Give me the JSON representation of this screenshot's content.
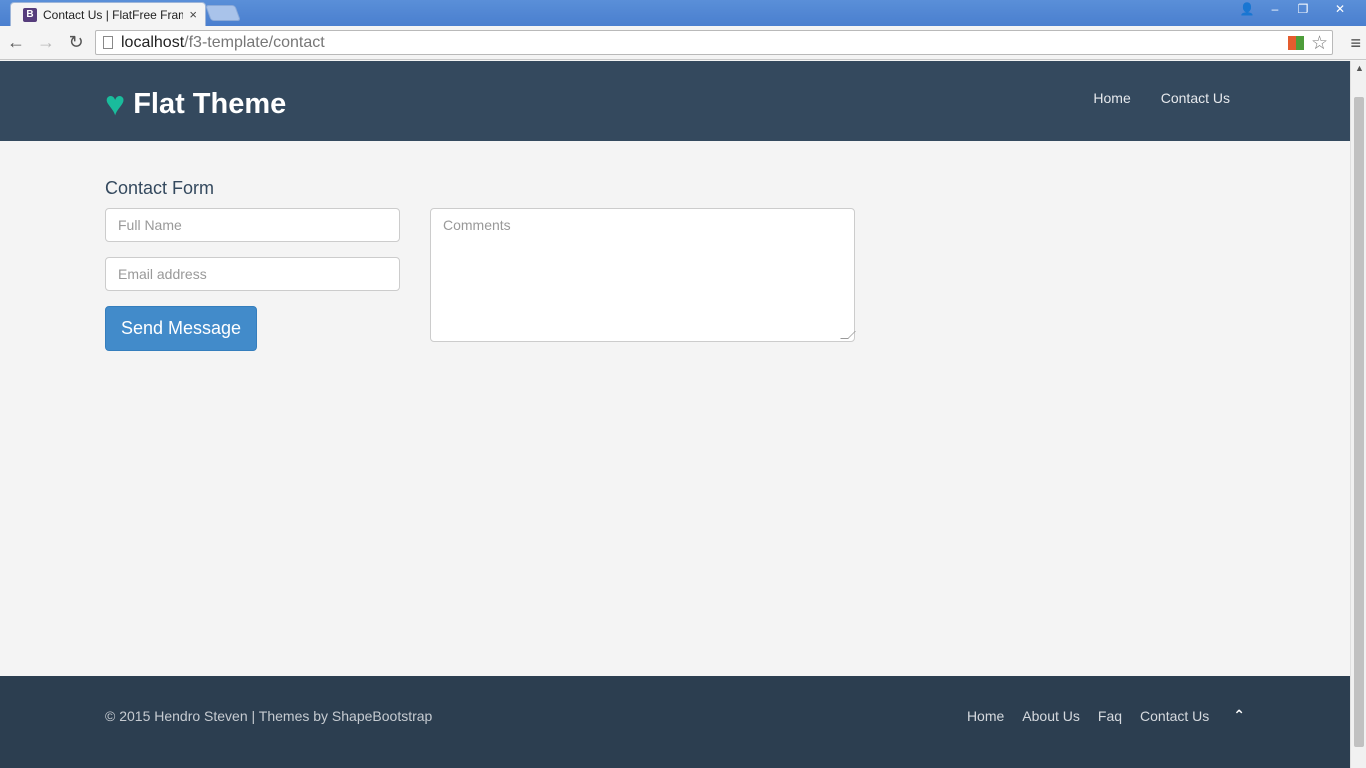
{
  "browser": {
    "tab_title": "Contact Us | FlatFree Frame",
    "favicon_letter": "B",
    "tab_close": "×",
    "url_host": "localhost",
    "url_path": "/f3-template/contact",
    "back_glyph": "←",
    "forward_glyph": "→",
    "reload_glyph": "↻",
    "star_glyph": "☆",
    "menu_glyph": "≡",
    "min_glyph": "–",
    "max_glyph": "❐",
    "close_glyph": "✕",
    "user_glyph": "👤"
  },
  "site": {
    "brand": "Flat Theme",
    "heart_glyph": "♥",
    "nav": [
      {
        "label": "Home"
      },
      {
        "label": "Contact Us"
      }
    ]
  },
  "form": {
    "title": "Contact Form",
    "full_name_placeholder": "Full Name",
    "email_placeholder": "Email address",
    "comments_placeholder": "Comments",
    "submit_label": "Send Message"
  },
  "footer": {
    "copyright": "© 2015 Hendro Steven | Themes by ShapeBootstrap",
    "links": [
      {
        "label": "Home"
      },
      {
        "label": "About Us"
      },
      {
        "label": "Faq"
      },
      {
        "label": "Contact Us"
      }
    ],
    "gotop_glyph": "⌃"
  },
  "colors": {
    "header_bg": "#34495e",
    "footer_bg": "#2c3e50",
    "accent": "#1abc9c",
    "button": "#428bca"
  }
}
